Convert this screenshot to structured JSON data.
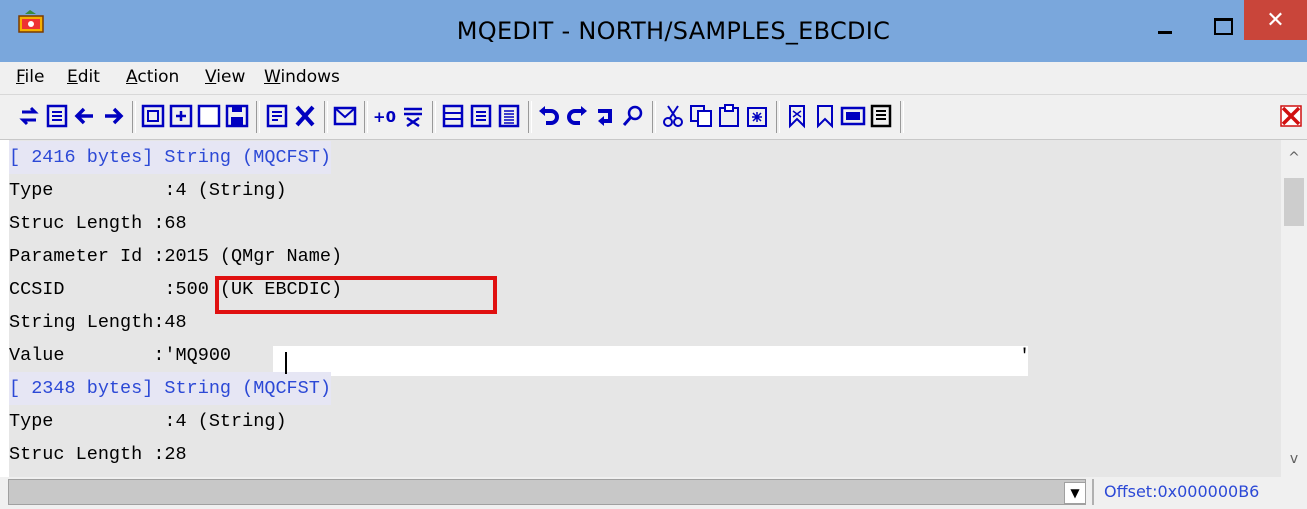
{
  "window": {
    "title": "MQEDIT - NORTH/SAMPLES_EBCDIC",
    "close_glyph": "✕",
    "accent_color": "#7aa7dc",
    "close_color": "#c9453a"
  },
  "menu": {
    "file": "File",
    "edit": "Edit",
    "action": "Action",
    "view": "View",
    "windows": "Windows"
  },
  "toolbar": {
    "icons": [
      "refresh-icon",
      "list-icon",
      "back-arrow-icon",
      "forward-arrow-icon",
      "copy-message-icon",
      "new-message-icon",
      "blank-page-icon",
      "save-icon",
      "text-view-icon",
      "delete-icon",
      "mail-icon",
      "add-zero-icon",
      "filter-icon",
      "page-one-icon",
      "page-two-icon",
      "page-three-icon",
      "undo-icon",
      "redo-icon",
      "repeat-icon",
      "find-icon",
      "cut-icon",
      "copy-icon",
      "paste-icon",
      "paste-special-icon",
      "bookmark-icon",
      "bookmark-outline-icon",
      "ok-icon",
      "properties-icon",
      "close-red-icon"
    ]
  },
  "content": {
    "rows": [
      {
        "text": "[ 2416 bytes] String (MQCFST)",
        "kind": "header"
      },
      {
        "text": "Type          :4 (String)",
        "kind": "field"
      },
      {
        "text": "Struc Length :68",
        "kind": "field"
      },
      {
        "text": "Parameter Id :2015 (QMgr Name)",
        "kind": "field"
      },
      {
        "text": "CCSID         :500 (UK EBCDIC)",
        "kind": "field"
      },
      {
        "text": "String Length:48",
        "kind": "field"
      },
      {
        "text": "Value        :'MQ900",
        "kind": "field"
      },
      {
        "text": "[ 2348 bytes] String (MQCFST)",
        "kind": "header"
      },
      {
        "text": "Type          :4 (String)",
        "kind": "field"
      },
      {
        "text": "Struc Length :28",
        "kind": "field"
      }
    ],
    "value_close_quote": "'",
    "highlight_color": "#e01010"
  },
  "status": {
    "dropdown_glyph": "▼",
    "offset": "Offset:0x000000B6"
  },
  "scroll": {
    "up_glyph": "^",
    "down_glyph": "v"
  }
}
